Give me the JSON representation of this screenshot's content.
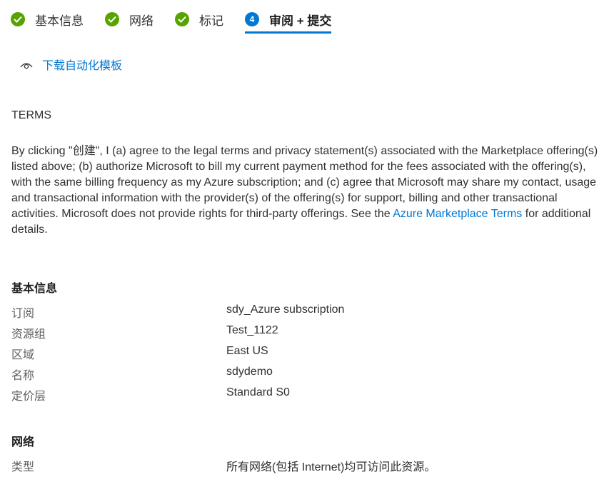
{
  "steps": [
    {
      "label": "基本信息",
      "state": "done"
    },
    {
      "label": "网络",
      "state": "done"
    },
    {
      "label": "标记",
      "state": "done"
    },
    {
      "label": "审阅 + 提交",
      "state": "active",
      "number": "4"
    }
  ],
  "download_link": "下载自动化模板",
  "terms": {
    "title": "TERMS",
    "body_before": "By clicking \"创建\", I (a) agree to the legal terms and privacy statement(s) associated with the Marketplace offering(s) listed above; (b) authorize Microsoft to bill my current payment method for the fees associated with the offering(s), with the same billing frequency as my Azure subscription; and (c) agree that Microsoft may share my contact, usage and transactional information with the provider(s) of the offering(s) for support, billing and other transactional activities. Microsoft does not provide rights for third-party offerings. See the ",
    "link": "Azure Marketplace Terms",
    "body_after": " for additional details."
  },
  "basics": {
    "title": "基本信息",
    "rows": [
      {
        "label": "订阅",
        "value": "sdy_Azure subscription"
      },
      {
        "label": "资源组",
        "value": "Test_1122"
      },
      {
        "label": "区域",
        "value": "East US"
      },
      {
        "label": "名称",
        "value": "sdydemo"
      },
      {
        "label": "定价层",
        "value": "Standard S0"
      }
    ]
  },
  "network": {
    "title": "网络",
    "rows": [
      {
        "label": "类型",
        "value": "所有网络(包括 Internet)均可访问此资源。"
      }
    ]
  },
  "colors": {
    "accent": "#0078d4",
    "success": "#57a300"
  }
}
